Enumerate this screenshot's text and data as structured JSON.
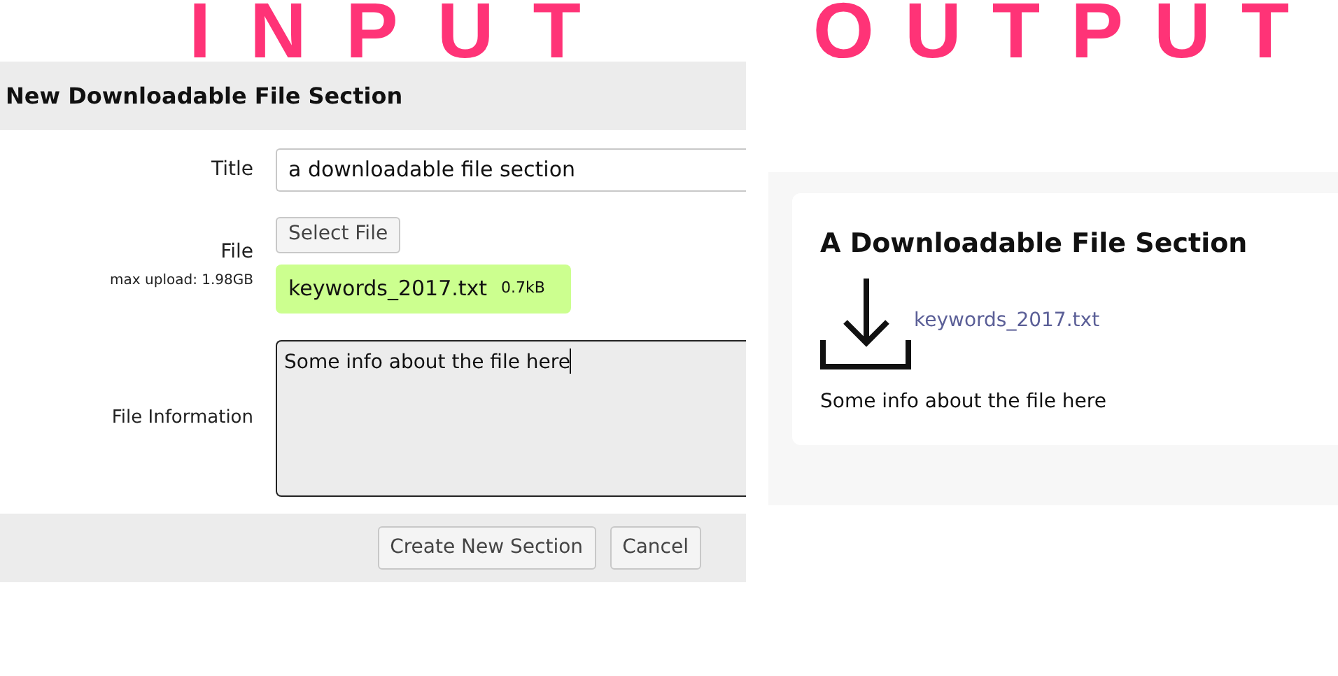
{
  "input_heading": "INPUT",
  "output_heading": "OUTPUT",
  "form": {
    "title": "New Downloadable File Section",
    "fields": [
      {
        "kind": "text",
        "label": "Title",
        "value": "a downloadable file section"
      },
      {
        "kind": "file",
        "label": "File",
        "hint": "max upload: 1.98GB",
        "button": "Select File",
        "file_name": "keywords_2017.txt",
        "file_size": "0.7kB"
      },
      {
        "kind": "textarea",
        "label": "File Information",
        "value": "Some info about the file here"
      }
    ],
    "buttons": [
      "Create New Section",
      "Cancel"
    ]
  },
  "output": {
    "title": "A Downloadable File Section",
    "link": "keywords_2017.txt",
    "description": "Some info about the file here"
  }
}
